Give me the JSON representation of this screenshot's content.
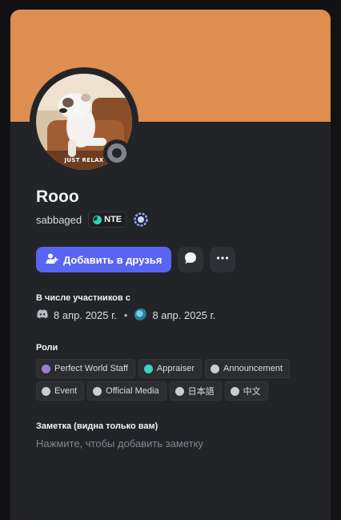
{
  "profile": {
    "display_name": "Rooo",
    "username": "sabbaged",
    "tag": "NTE",
    "banner_color": "#dd8e50",
    "avatar_caption": "JUST RELAX",
    "status": "offline"
  },
  "actions": {
    "add_friend_label": "Добавить в друзья",
    "message_icon": "message-bubble-icon",
    "more_icon": "more-dots-icon"
  },
  "member_since": {
    "title": "В числе участников с",
    "discord_date": "8 апр. 2025 г.",
    "separator": "•",
    "server_date": "8 апр. 2025 г."
  },
  "roles": {
    "title": "Роли",
    "items": [
      {
        "name": "Perfect World Staff",
        "color": "#9a7be0"
      },
      {
        "name": "Appraiser",
        "color": "#3ad6c1"
      },
      {
        "name": "Announcement",
        "color": "#c9ccd1"
      },
      {
        "name": "Event",
        "color": "#c9ccd1"
      },
      {
        "name": "Official Media",
        "color": "#c9ccd1"
      },
      {
        "name": "日本語",
        "color": "#c9ccd1"
      },
      {
        "name": "中文",
        "color": "#c9ccd1"
      }
    ]
  },
  "note": {
    "title": "Заметка (видна только вам)",
    "placeholder": "Нажмите, чтобы добавить заметку"
  }
}
